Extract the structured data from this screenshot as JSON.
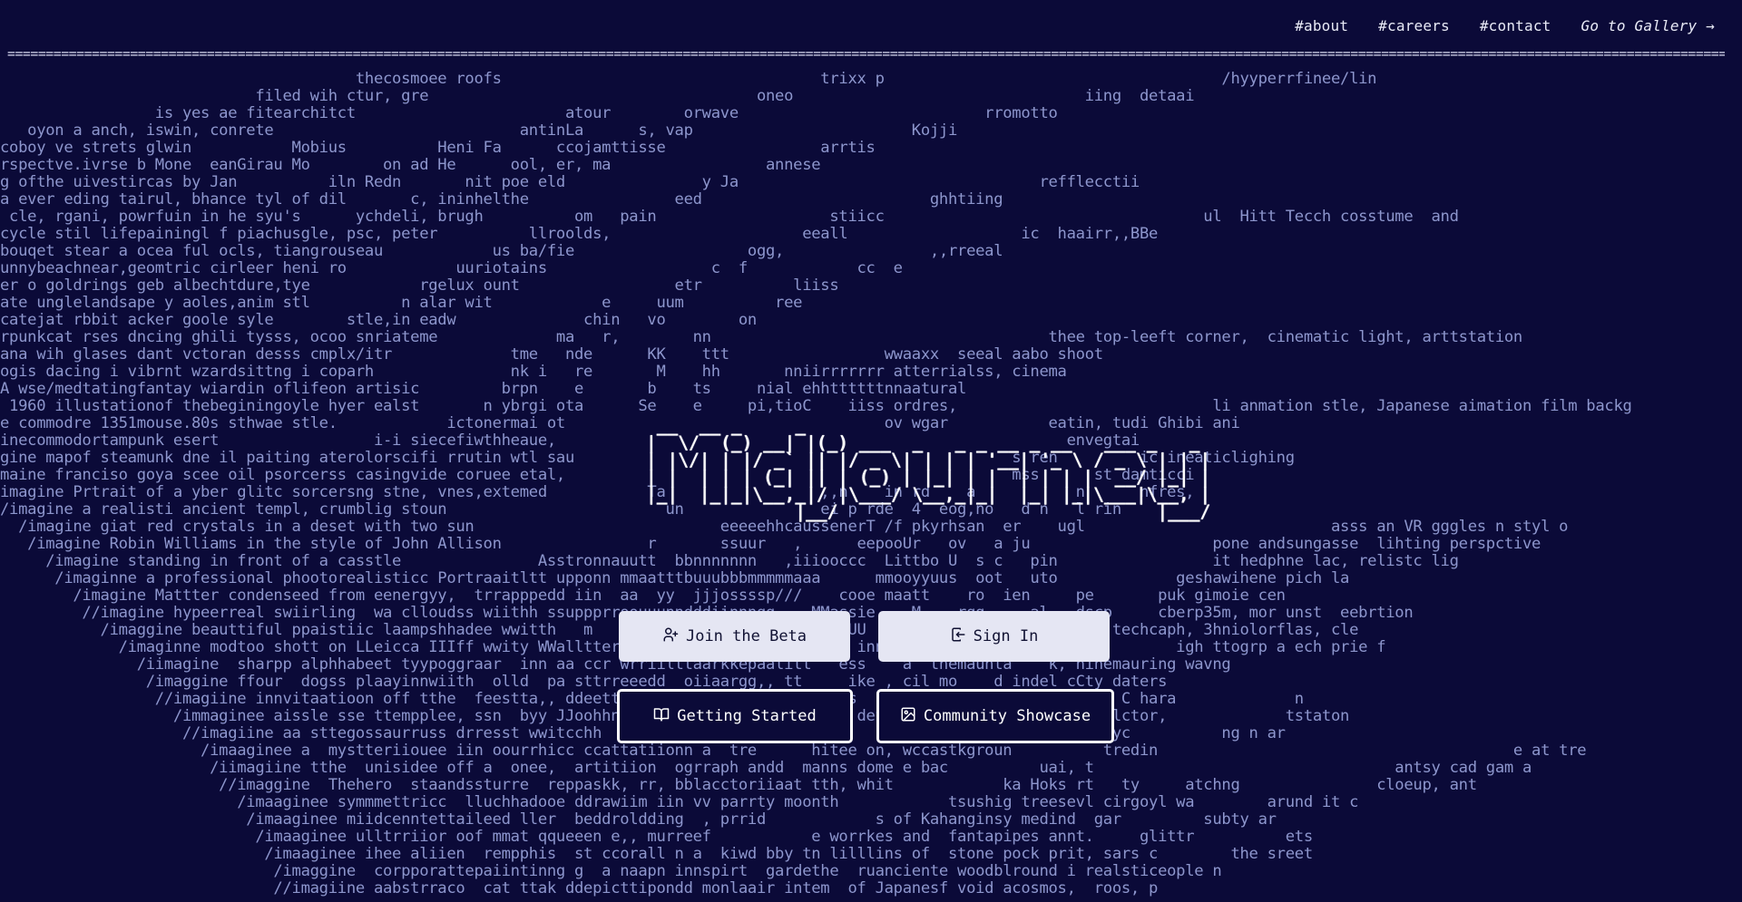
{
  "nav": {
    "about": "#about",
    "careers": "#careers",
    "contact": "#contact",
    "gallery": "Go to Gallery →"
  },
  "divider": "===================================================================================================================================================================================================================================",
  "logo_ascii": [
    " __  __ _     _                                    ",
    "|  \\/  (_) __| |(_) ___  _   _ _ __ _ __   ___ _   _ ",
    "| |\\/| | |/ _` || |/ _ \\| | | | '__| '_ \\ / _ \\ | | |",
    "| |  | | | (_| || | (_) | |_| | |  | | | |  __/ |_| |",
    "|_|  |_|_|\\__,_|/ |\\___/ \\__,_|_|  |_| |_|\\___|\\__, |",
    "              |__/                              |___/ "
  ],
  "background_lines": [
    "                                       thecosmoee roofs                                   trixx p                                     /hyyperrfinee/lin",
    "                            filed wih ctur, gre                                    oneo                                iing  detaai",
    "                 is yes ae fitearchitct                       atour        orwave                           rromotto",
    "   oyon a anch, iswin, conrete                           antinLa      s, vap                        Kojji",
    "coboy ve strets glwin           Mobius          Heni Fa      ccojamttisse                 arrtis",
    "rspectve.ivrse b Mone  eanGirau Mo        on ad He      ool, er, ma                 annese",
    "g ofthe uivestircas by Jan          iln Redn       nit poe eld               y Ja                                 refflecctii",
    "a ever eding tairul, bhance tyl of dil       c, ininhelthe                eed                         ghhtiing",
    " cle, rgani, powrfuin in he syu's      ychdeli, brugh          om   pain                   stiicc                                   ul  Hitt Tecch cosstume  and",
    "cycle stil lifepainingl f piachusgle, psc, peter          llroolds,                     eeall                   ic  haairr,,BBe",
    "bouqet stear a ocea ful ocls, tiangrouseau            us ba/fie                   ogg,                ,,rreeal",
    "unnybeachnear,geomtric cirleer heni ro            uuriotains                  c  f            cc  e",
    "er o goldrings geb albechtdure,tye            rgelux ount                 etr          liiss",
    "ate unglelandsape y aoles,anim stl          n alar wit            e     uum          ree",
    "catejat rbbit acker goole syle        stle,in eadw              chin   vo        on",
    "rpunkcat rses dncing ghili tysss, ocoo snriateme             ma   r,        nn                                     thee top-leeft corner,  cinematic light, arttstation",
    "ana wih glases dant vctoran desss cmplx/itr             tme   nde      KK    ttt                 wwaaxx  seeal aabo shoot",
    "ogis dacing i vibrnt wzardsittng i coparh               nk i   re       M    hh       nniirrrrrrr atterrialss, cinema",
    "A wse/medtatingfantay wiardin oflifeon artisic         brpn    e       b    ts     nial ehhttttttnnaatural",
    " 1960 illustationof thebeginingoyle hyer ealst       n ybrgi ota      Se    e     pi,tioC    iiss ordres,                            li anmation stle, Japanese aimation film backg",
    "e commodre 1351mouse.80s sthwae stle.            ictonermai ot                                   ov wgar           eatin, tudi Ghibi ani",
    "inecommodortampunk esert                 i-i siecefiwthheaue,                                                        envegtai",
    "gine mapof steamunk dne il paiting aterolorscifi rrutin wtl sau                                                s ren         ic ineaticlighing",
    "maine franciso goya scee oil psorcerss casingvide coruee etal,                                                 mss      st damticci",
    "imagine Prtrait of a yber glitc sorcersng stne, vnes,extemed           Ta                 ,,n    in rd    a           n      nfres,",
    "/imagine a realisti ancient templ, crumblig stoun                        un               ei p rde  4  eog,no   d n   l rin",
    "  /imagine giat red crystals in a deset with two sun                           eeeeehhcaussenerT /f pkyrhsan  er    ugl                           asss an VR gggles n styl o",
    "   /imagine Robin Williams in the style of John Allison                r       ssuur   ,      eepooUr   ov   a ju                    pone andsungasse  lihting perspctive",
    "     /imagine standing in front of a casstle               Asstronnauutt  bbnnnnnnn   ,iiiooccc  Littbo U  s c   pin                 it hedphne lac, relistc lig",
    "      /imaginne a professional phootorealisticc Portraaitltt upponn mmaatttbuuubbbmmmmmaaa      mmooyyuus  oot   uto             geshawihene pich la",
    "        /imagine Mattter condenseed from eenergyy,  trrapppedd iin  aa  yy  jjjossssp///    cooe maatt    ro  ien     pe       puk gimoie cen",
    "         //imagine hypeerreal swiirling  wa clloudss wiithh ssuppprroouuunndddiinnngg    MMassie,,  M    rgg     al   dscp     cberp35m, mor unst  eebrtion",
    "           /imaggine beauttiful ppaistiic laampshhadee wwitth   m   ffllloowweerrss  b  ccullUU  b    ttrr  cal    lad    techcaph, 3hniolorflas, cle",
    "             /imaginne modtoo shott on LLeicca IIIff wwity WWallttereedd  ffrroo  wwiilliinn  inng    wiitt  ttopiiccaain        igh ttogrp a ech prie f",
    "               /iimagine  sharpp alphhabeet tyypoggraar  inn aa ccr wrriilttaarkkepaalitt   ess    a  themaunta    k, hinemauring wavng",
    "                /imaggine ffour  dogss plaayinnwiith  olld  pa sttrreeedd  oiiaargg,, tt     ike , cil mo    d indel cCty daters",
    "                 //imagiine innvitaatioon off tthe  feestta,, ddeettaaiilinngeennttllee    kks  iiledutif     en an indoud C hara             n",
    "                   /immaginee aissle sse ttempplee, ssn  byy JJoohhnn  SSiinnggeerr  SSaarr   det  a    rd   iinngnaall  ulctor,             tstaton",
    "                    //imagiine aa sttegossaurruss drresst wwitcchh  sstoorsdraal  tiingghhlle   nn     nd ninndole inng,  yc          ng n ar",
    "                      /imaaginee a  mystteriiouee iin oourrhicc ccattatiionn a  tre      hitee on, wccastkgroun          tredin                                       e at tre",
    "                       /iimagiine tthe  unisidee off a  onee,  artitiion  ogrraph andd  manns dome e bac          uai, t                                 antsy cad gam a",
    "                        //imaggine  Thehero  staandssturre  reppaskk, rr, bblacctoriiaat tth, whit            ka Hoks rt   ty     atchng               cloeup, ant",
    "                          /imaaginee symmmettricc  lluchhadooe ddrawiim iin vv parrty moonth            tsushig treesevl cirgoyl wa        arund it c",
    "                           /imaaginee miidcenntettaileed ller  beddroldding  , prrid            s of Kahanginsy medind  gar         subty ar",
    "                            /imaaginee ulltrriior oof mmat qqueeen e,, murreef           e worrkes and  fantapipes annt.     glittr          ets",
    "                             /imaaginee ihee aliien  rempphis  st ccorall n a  kiwd bby tn lilllins of  stone pock prit, sars c        the sreet",
    "                              /imaggine  corpporattepaiintinng g  a naapn innspirt  gardethe  ruanciente woodblround i realsticeople n",
    "                              //imagiine aabstrraco  cat ttak ddepicttipondd monlaair intem  of Japanesf void acosmos,  roos, p"
  ],
  "buttons": {
    "join": {
      "label": "Join the Beta",
      "icon": "user-plus-icon"
    },
    "signin": {
      "label": "Sign In",
      "icon": "sign-in-icon"
    },
    "getting_started": {
      "label": "Getting Started",
      "icon": "book-open-icon"
    },
    "showcase": {
      "label": "Community Showcase",
      "icon": "image-icon"
    }
  },
  "colors": {
    "background": "#0b0a38",
    "background_text": "#8d96cd",
    "foreground": "#ffffff",
    "button_light": "#e5e6f3"
  }
}
